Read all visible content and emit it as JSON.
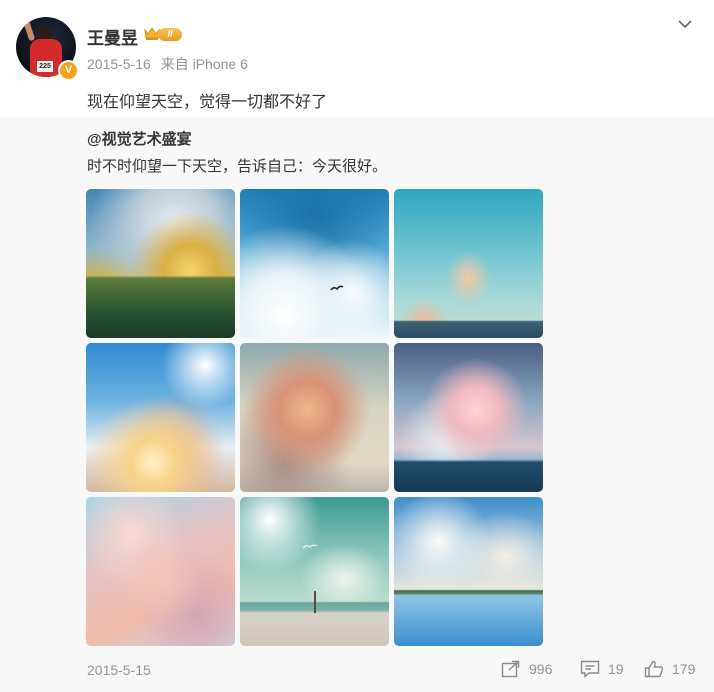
{
  "post": {
    "author": "王曼昱",
    "level_badge": "II",
    "verified_badge": "V",
    "avatar_bib": "225",
    "timestamp": "2015-5-16",
    "source": "来自 iPhone 6",
    "text": "现在仰望天空，觉得一切都不好了"
  },
  "repost": {
    "author": "@视觉艺术盛宴",
    "text": "时不时仰望一下天空，告诉自己：今天很好。",
    "photos": [
      "sky-photo-1",
      "sky-photo-2",
      "sky-photo-3",
      "sky-photo-4",
      "sky-photo-5",
      "sky-photo-6",
      "sky-photo-7",
      "sky-photo-8",
      "sky-photo-9"
    ],
    "date": "2015-5-15",
    "actions": {
      "share_count": "996",
      "comment_count": "19",
      "like_count": "179"
    }
  },
  "icons": [
    "crown-icon",
    "chevron-down-icon",
    "share-icon",
    "comment-icon",
    "like-icon"
  ],
  "colors": {
    "accent": "#f7a21b",
    "muted_text": "#939393",
    "repost_bg": "#f8f8f8"
  }
}
